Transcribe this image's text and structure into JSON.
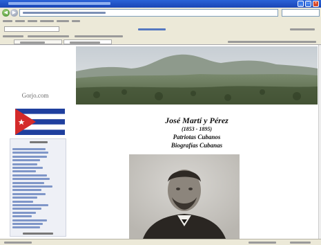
{
  "window": {
    "title": ""
  },
  "toolbar": {
    "address": ""
  },
  "menubar": {
    "items": [
      "",
      "",
      "",
      "",
      "",
      ""
    ]
  },
  "google_bar": {
    "search_text": ""
  },
  "links_bar": {
    "items": [
      "",
      "",
      ""
    ]
  },
  "tabs": [
    {
      "label": ""
    },
    {
      "label": ""
    }
  ],
  "sidebar": {
    "brand": "Gorjo.com",
    "menu_title": "",
    "links": [
      "",
      "",
      "",
      "",
      "",
      "",
      "",
      "",
      "",
      "",
      "",
      "",
      "",
      "",
      "",
      "",
      "",
      "",
      "",
      "",
      "",
      ""
    ],
    "menu_footer": ""
  },
  "main": {
    "title": "José Martí y Pérez",
    "years": "(1853 - 1895)",
    "subtitle1": "Patriotas Cubanos",
    "subtitle2": "Biografías Cubanas"
  },
  "status": {
    "text": ""
  },
  "colors": {
    "flag_blue": "#1f3f9e",
    "flag_red": "#d42a2a",
    "link": "#3b5bb5",
    "title_bar": "#2b63d8"
  }
}
